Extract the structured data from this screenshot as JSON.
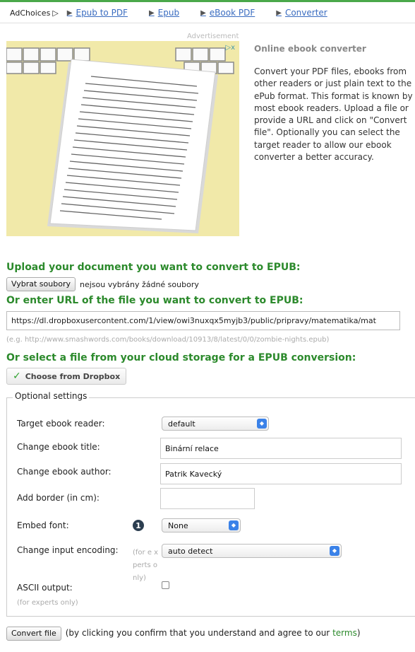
{
  "ad_bar": {
    "adchoices_label": "AdChoices",
    "links": [
      "Epub to PDF",
      "Epub",
      "eBook PDF",
      "Converter"
    ]
  },
  "ad": {
    "label": "Advertisement",
    "close_glyph": "▷ⅹ"
  },
  "sidebar": {
    "title": "Online ebook converter",
    "description": "Convert your PDF files, ebooks from other readers or just plain text to the ePub format. This format is known by most ebook readers. Upload a file or provide a URL and click on \"Convert file\". Optionally you can select the target reader to allow our ebook converter a better accuracy."
  },
  "upload": {
    "heading": "Upload your document you want to convert to EPUB:",
    "choose_button": "Vybrat soubory",
    "status": "nejsou vybrány žádné soubory"
  },
  "url": {
    "heading": "Or enter URL of the file you want to convert to EPUB:",
    "value": "https://dl.dropboxusercontent.com/1/view/owi3nuxqx5myjb3/public/pripravy/matematika/mat",
    "example": "(e.g. http://www.smashwords.com/books/download/10913/8/latest/0/0/zombie-nights.epub)"
  },
  "cloud": {
    "heading": "Or select a file from your cloud storage for a EPUB conversion:",
    "dropbox_button": "Choose from Dropbox"
  },
  "settings": {
    "legend": "Optional settings",
    "target_reader": {
      "label": "Target ebook reader:",
      "value": "default"
    },
    "title": {
      "label": "Change ebook title:",
      "value": "Binární relace"
    },
    "author": {
      "label": "Change ebook author:",
      "value": "Patrik Kavecký"
    },
    "border": {
      "label": "Add border (in cm):",
      "value": ""
    },
    "embed_font": {
      "label": "Embed font:",
      "value": "None",
      "info_glyph": "1"
    },
    "encoding": {
      "label": "Change input encoding:",
      "hint": "(for e xperts only)",
      "value": "auto detect"
    },
    "ascii": {
      "label": "ASCII output:",
      "hint": "(for experts only)",
      "checked": false
    }
  },
  "submit": {
    "button": "Convert file",
    "text_before": "(by clicking you confirm that you understand and agree to our ",
    "terms_link": "terms",
    "text_after": ")"
  },
  "colors": {
    "heading_green": "#2c8a2c",
    "link_blue": "#3a6cc0",
    "select_arrow_blue": "#3b82e8"
  }
}
